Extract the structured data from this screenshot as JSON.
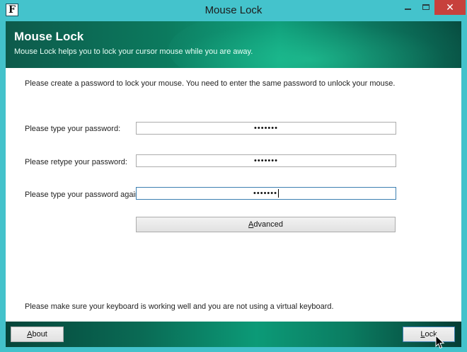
{
  "window": {
    "title": "Mouse Lock",
    "icon_letter": "F",
    "close_symbol": "✕"
  },
  "banner": {
    "title": "Mouse Lock",
    "subtitle": "Mouse Lock helps you to lock your cursor mouse while you are away."
  },
  "main": {
    "intro": "Please create a password to lock your mouse. You need to enter the same password to unlock your mouse.",
    "fields": [
      {
        "label": "Please type your password:",
        "value": "•••••••"
      },
      {
        "label": "Please retype your password:",
        "value": "•••••••"
      },
      {
        "label": "Please type your password again:",
        "value": "•••••••"
      }
    ],
    "advanced_label": "Advanced",
    "advanced_mnemonic": "A",
    "advanced_rest": "dvanced",
    "note": "Please make sure your keyboard is working well and you are not using a virtual keyboard."
  },
  "footer": {
    "about_mnemonic": "A",
    "about_rest": "bout",
    "lock_mnemonic": "L",
    "lock_rest": "ock"
  },
  "colors": {
    "titlebar": "#44c3cc",
    "banner": "#0c7a5e",
    "close": "#c7413c"
  }
}
